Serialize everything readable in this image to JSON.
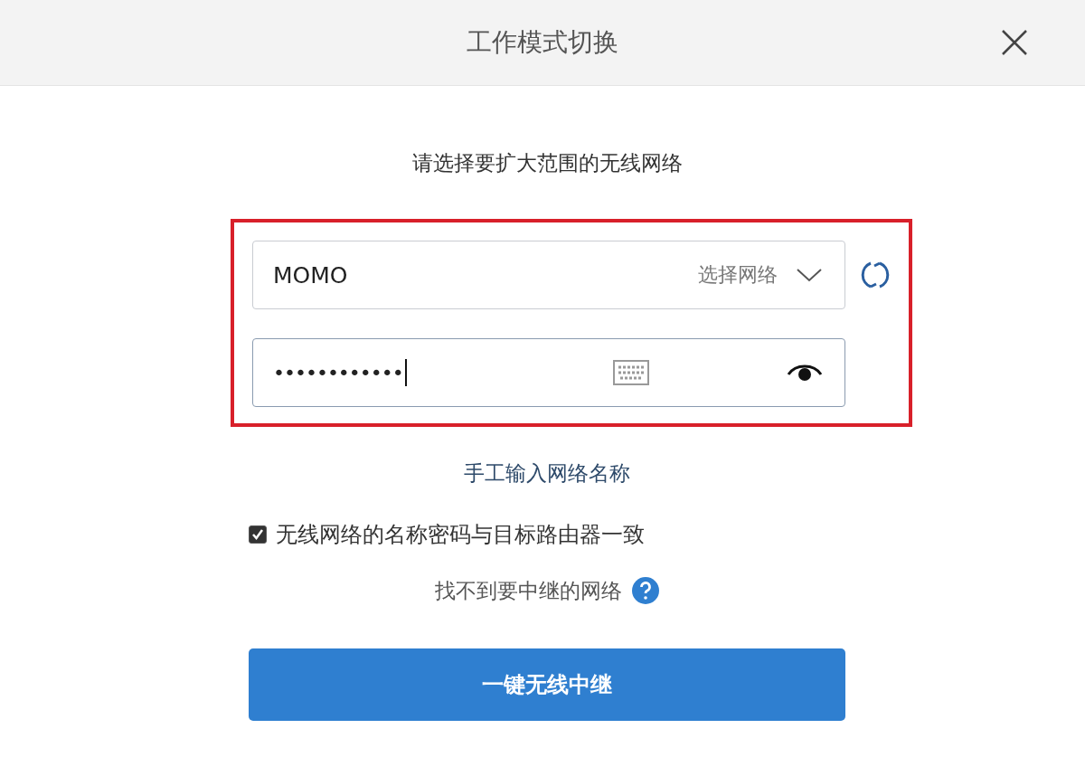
{
  "dialog": {
    "title": "工作模式切换"
  },
  "prompt": "请选择要扩大范围的无线网络",
  "highlight": true,
  "network_select": {
    "value": "MOMO",
    "hint": "选择网络"
  },
  "password": {
    "value": "••••••••••••"
  },
  "manual_link": "手工输入网络名称",
  "same_credentials": {
    "label": "无线网络的名称密码与目标路由器一致",
    "checked": true
  },
  "help_link": "找不到要中继的网络",
  "submit": "一键无线中继"
}
